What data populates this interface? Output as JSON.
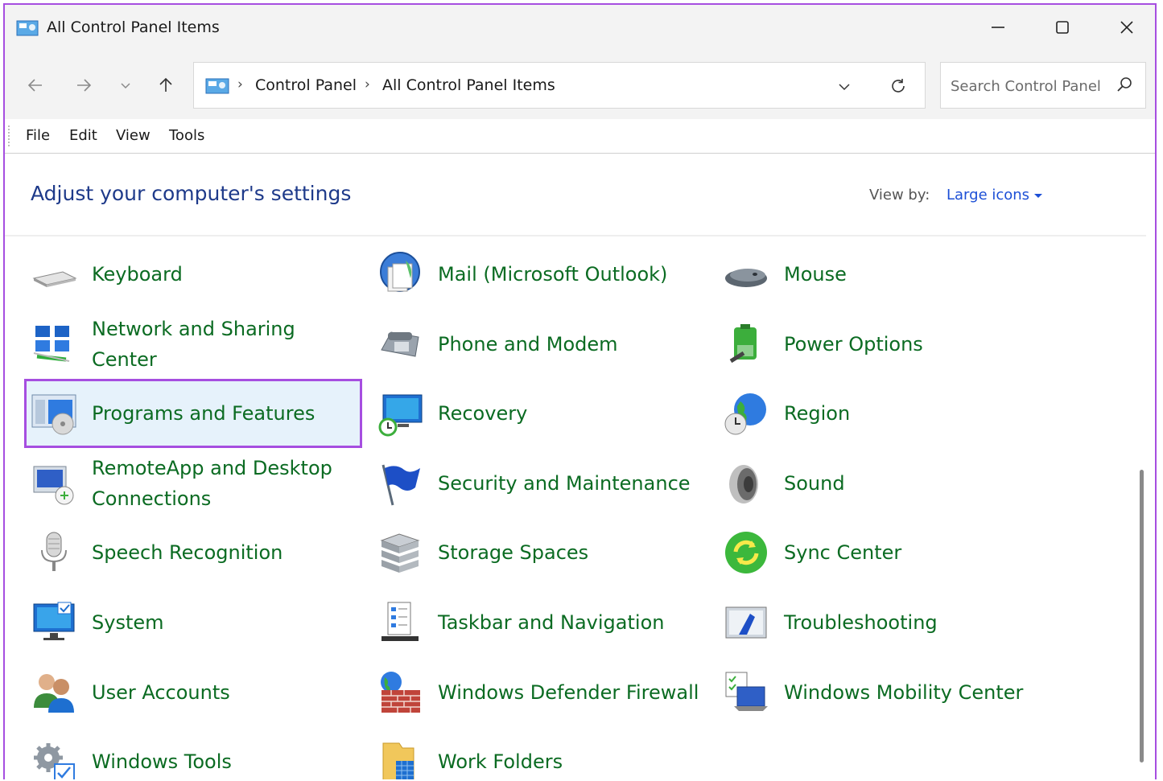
{
  "window": {
    "title": "All Control Panel Items"
  },
  "nav": {
    "breadcrumb": [
      "Control Panel",
      "All Control Panel Items"
    ],
    "search_placeholder": "Search Control Panel"
  },
  "menu": [
    "File",
    "Edit",
    "View",
    "Tools"
  ],
  "header": {
    "title": "Adjust your computer's settings",
    "view_by_label": "View by:",
    "view_by_value": "Large icons"
  },
  "items": [
    {
      "label": "Keyboard",
      "icon": "keyboard-icon"
    },
    {
      "label": "Mail (Microsoft Outlook)",
      "icon": "mail-icon"
    },
    {
      "label": "Mouse",
      "icon": "mouse-icon"
    },
    {
      "label": "Network and Sharing Center",
      "icon": "network-icon"
    },
    {
      "label": "Phone and Modem",
      "icon": "phone-icon"
    },
    {
      "label": "Power Options",
      "icon": "power-icon"
    },
    {
      "label": "Programs and Features",
      "icon": "programs-icon",
      "selected": true
    },
    {
      "label": "Recovery",
      "icon": "recovery-icon"
    },
    {
      "label": "Region",
      "icon": "region-icon"
    },
    {
      "label": "RemoteApp and Desktop Connections",
      "icon": "remoteapp-icon"
    },
    {
      "label": "Security and Maintenance",
      "icon": "security-flag-icon"
    },
    {
      "label": "Sound",
      "icon": "speaker-icon"
    },
    {
      "label": "Speech Recognition",
      "icon": "microphone-icon"
    },
    {
      "label": "Storage Spaces",
      "icon": "storage-icon"
    },
    {
      "label": "Sync Center",
      "icon": "sync-icon"
    },
    {
      "label": "System",
      "icon": "system-monitor-icon"
    },
    {
      "label": "Taskbar and Navigation",
      "icon": "taskbar-icon"
    },
    {
      "label": "Troubleshooting",
      "icon": "troubleshooting-icon"
    },
    {
      "label": "User Accounts",
      "icon": "users-icon"
    },
    {
      "label": "Windows Defender Firewall",
      "icon": "firewall-icon"
    },
    {
      "label": "Windows Mobility Center",
      "icon": "mobility-icon"
    },
    {
      "label": "Windows Tools",
      "icon": "tools-gear-icon"
    },
    {
      "label": "Work Folders",
      "icon": "work-folders-icon"
    }
  ],
  "colors": {
    "link": "#0b6b22",
    "heading": "#1e3a8a",
    "accent": "#a64ee0",
    "selected_bg": "#e6f2fb"
  }
}
